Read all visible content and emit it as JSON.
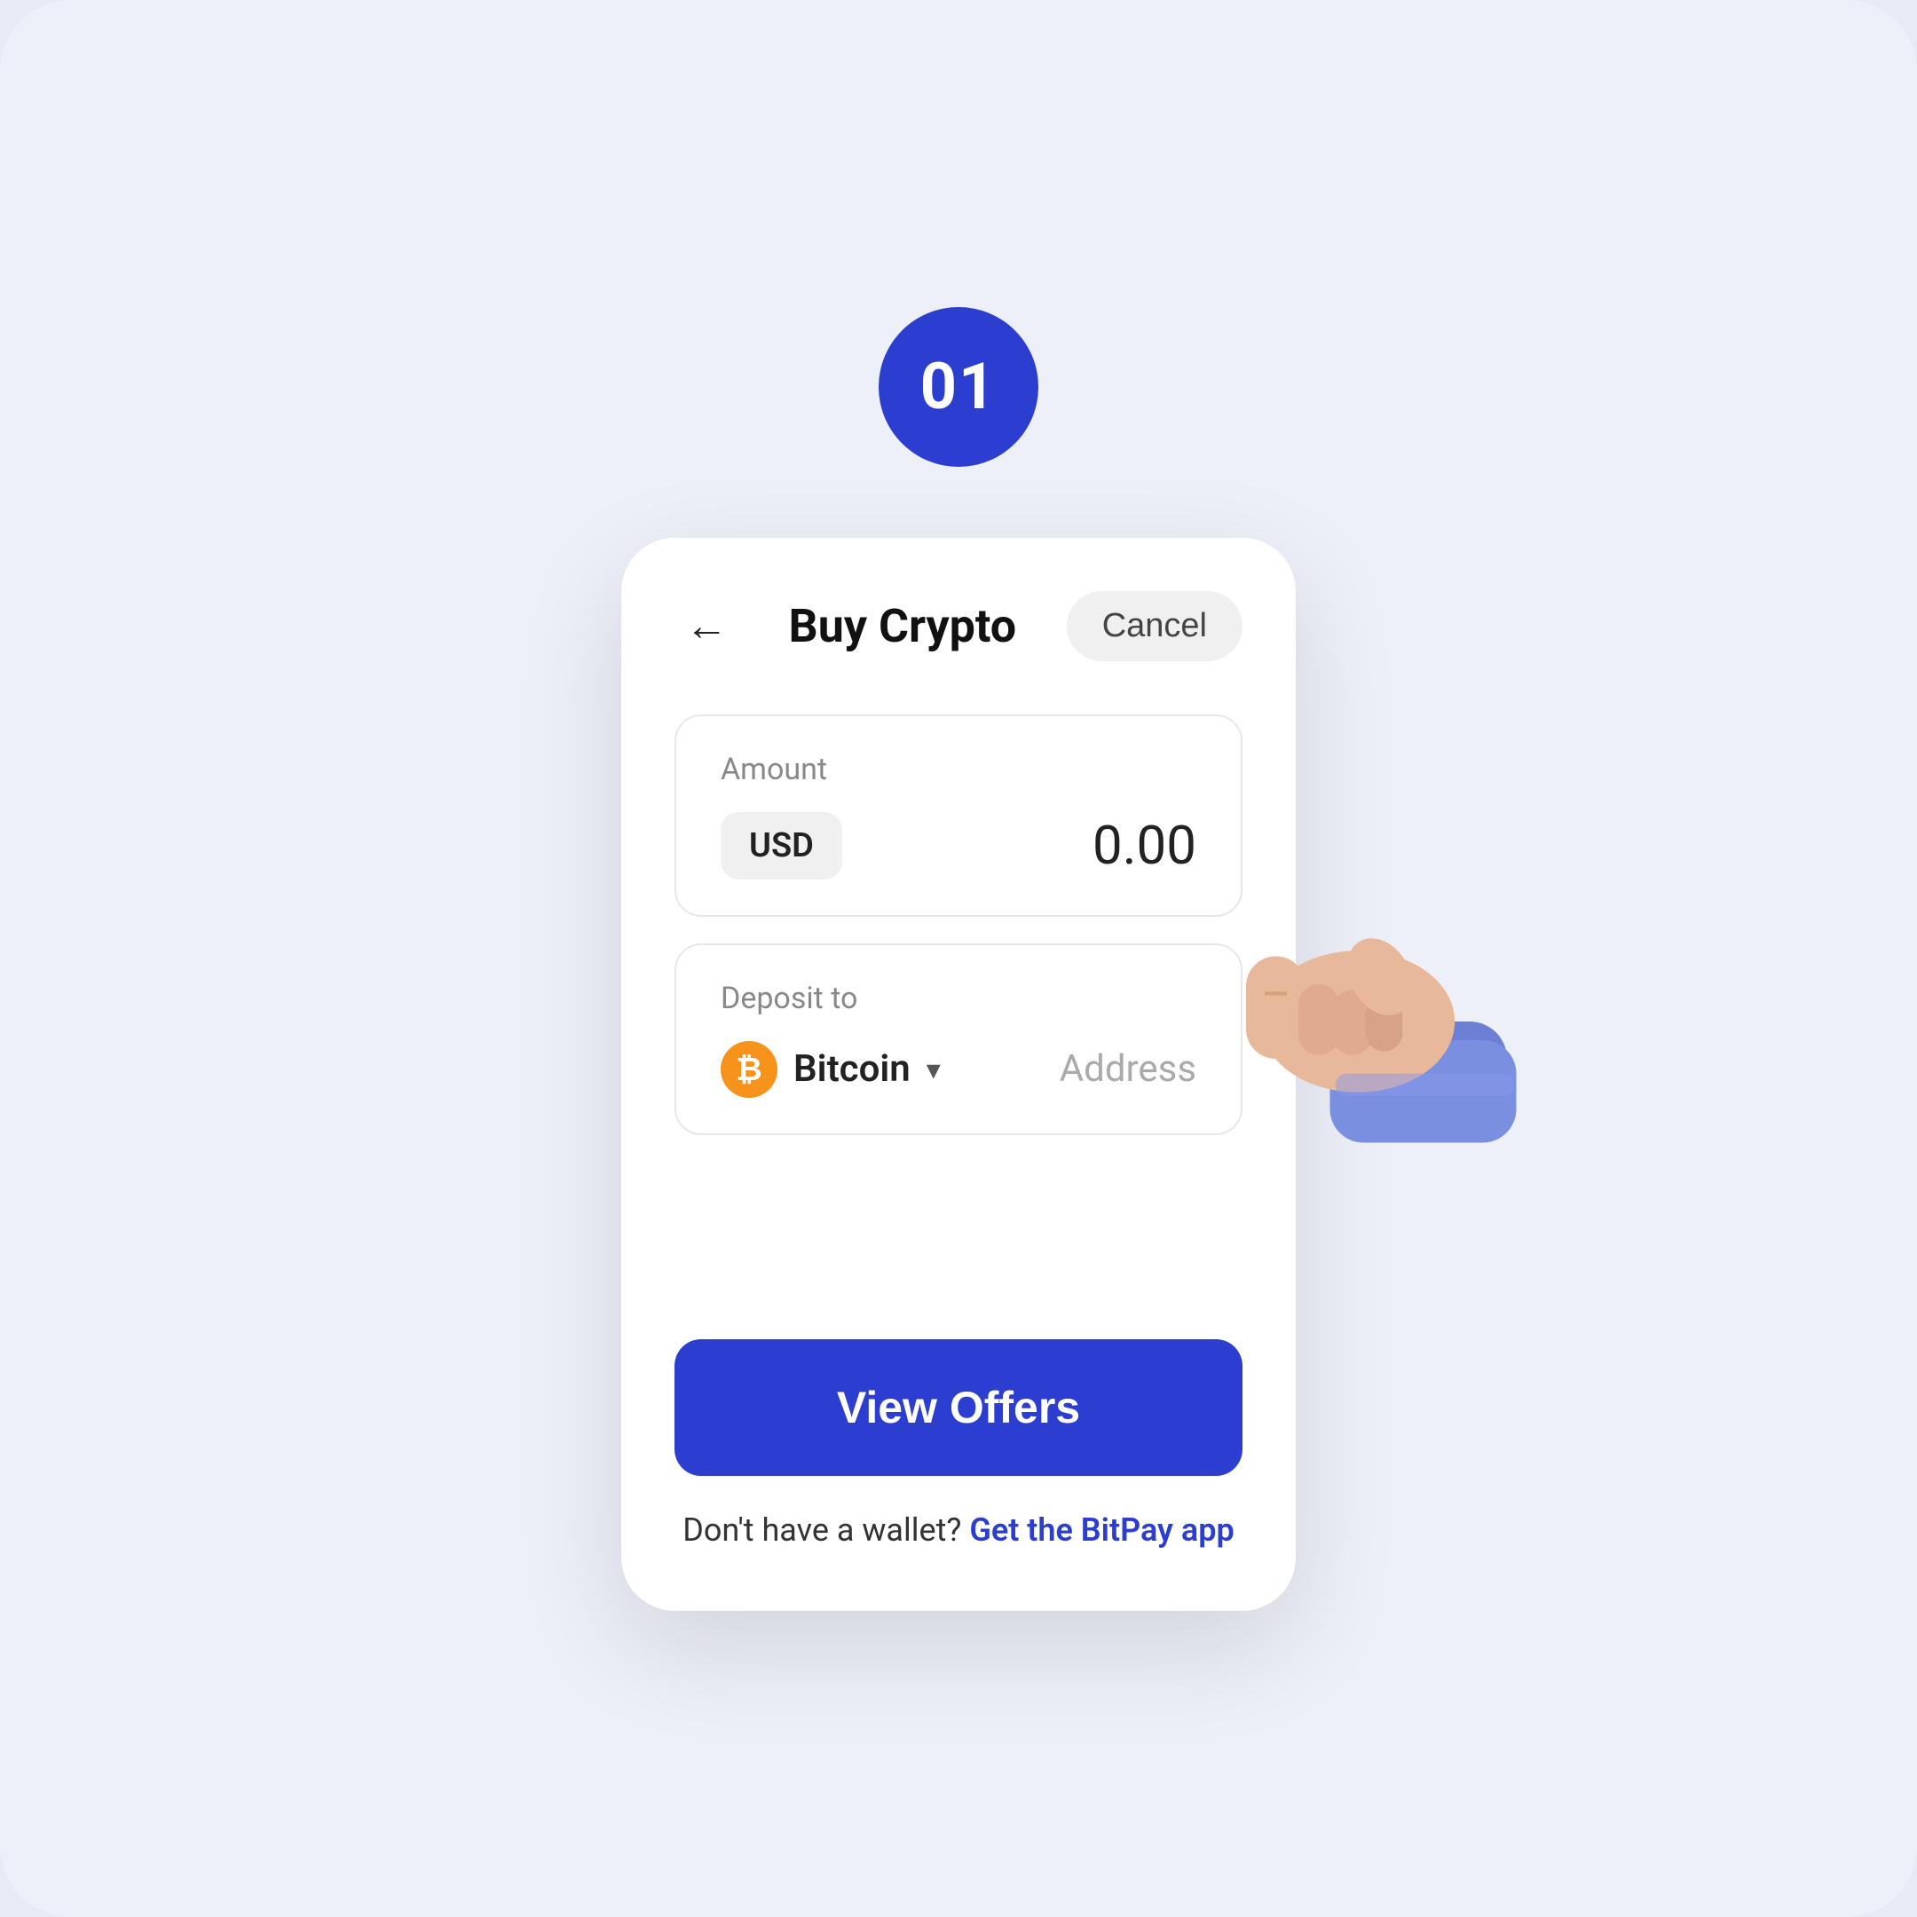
{
  "step": {
    "number": "01"
  },
  "header": {
    "back_label": "←",
    "title": "Buy Crypto",
    "cancel_label": "Cancel"
  },
  "amount_section": {
    "label": "Amount",
    "currency": "USD",
    "value": "0.00"
  },
  "deposit_section": {
    "label": "Deposit to",
    "coin_name": "Bitcoin",
    "address_placeholder": "Address"
  },
  "actions": {
    "view_offers_label": "View Offers"
  },
  "footer": {
    "text": "Don't have a wallet?",
    "link_text": "Get the BitPay app"
  }
}
